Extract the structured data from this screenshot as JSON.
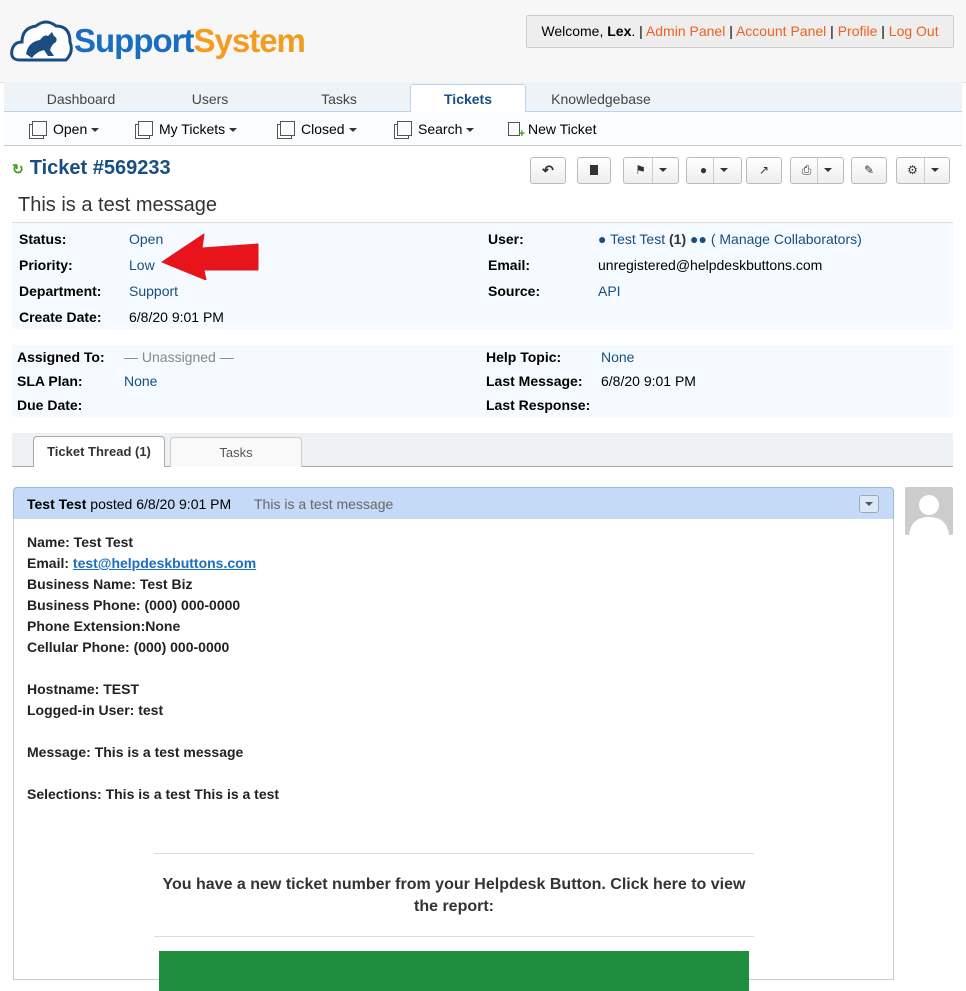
{
  "header": {
    "logo_part1": "Support",
    "logo_part2": "System",
    "welcome_prefix": "Welcome, ",
    "user": "Lex",
    "links": [
      "Admin Panel",
      "Account Panel",
      "Profile",
      "Log Out"
    ]
  },
  "nav": {
    "tabs": [
      "Dashboard",
      "Users",
      "Tasks",
      "Tickets",
      "Knowledgebase"
    ],
    "active": "Tickets"
  },
  "subnav": {
    "items": [
      "Open",
      "My Tickets",
      "Closed",
      "Search",
      "New Ticket"
    ]
  },
  "ticket": {
    "number": "Ticket #569233",
    "subject": "This is a test message"
  },
  "info1": {
    "status_label": "Status:",
    "status": "Open",
    "priority_label": "Priority:",
    "priority": "Low",
    "department_label": "Department:",
    "department": "Support",
    "create_label": "Create Date:",
    "create_date": "6/8/20 9:01 PM",
    "user_label": "User:",
    "user_name": "Test Test",
    "user_count": "(1)",
    "collab": "( Manage Collaborators)",
    "email_label": "Email:",
    "email": "unregistered@helpdeskbuttons.com",
    "source_label": "Source:",
    "source": "API"
  },
  "info2": {
    "assigned_label": "Assigned To:",
    "assigned": "— Unassigned —",
    "sla_label": "SLA Plan:",
    "sla": "None",
    "due_label": "Due Date:",
    "topic_label": "Help Topic:",
    "topic": "None",
    "lastmsg_label": "Last Message:",
    "last_message": "6/8/20 9:01 PM",
    "lastresp_label": "Last Response:"
  },
  "thread": {
    "tabs": [
      "Ticket Thread (1)",
      "Tasks"
    ],
    "poster": "Test Test",
    "posted": " posted 6/8/20 9:01 PM",
    "title": "This is a test message",
    "body": {
      "name": "Name: Test Test",
      "email_label": "Email: ",
      "email": "test@helpdeskbuttons.com",
      "business": "Business Name: Test Biz",
      "phone": "Business Phone: (000) 000-0000",
      "ext": "Phone Extension:None",
      "cell": "Cellular Phone: (000) 000-0000",
      "host": "Hostname: TEST",
      "logged": "Logged-in User: test",
      "message": "Message: This is a test message",
      "selections": "Selections: This is a test This is a test",
      "cta": "You have a new ticket number from your Helpdesk Button. Click here to view the report:"
    }
  },
  "colors": {
    "brand_blue": "#1a6ec1",
    "brand_orange": "#f39c1f",
    "link_orange": "#f0601f",
    "arrow_red": "#e8141b",
    "cta_green": "#1e8e3e"
  }
}
